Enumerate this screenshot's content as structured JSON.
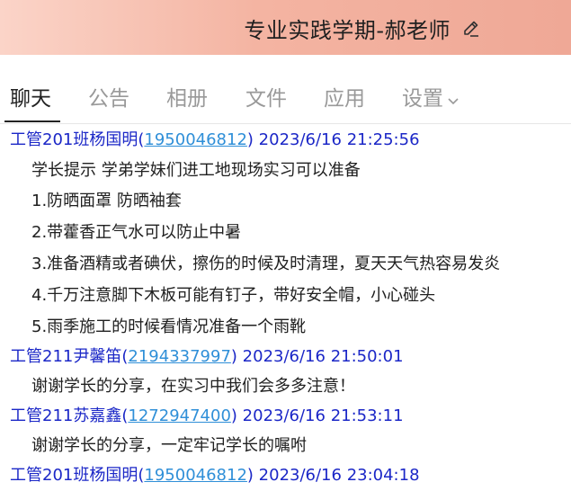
{
  "window": {
    "title": "专业实践学期-郝老师",
    "edit_icon": "pencil-icon"
  },
  "tabs": [
    {
      "label": "聊天",
      "active": true
    },
    {
      "label": "公告",
      "active": false
    },
    {
      "label": "相册",
      "active": false
    },
    {
      "label": "文件",
      "active": false
    },
    {
      "label": "应用",
      "active": false
    },
    {
      "label": "设置",
      "active": false,
      "icon": "chevron-down-icon"
    }
  ],
  "messages": [
    {
      "sender": "工管201班杨国明",
      "qq": "1950046812",
      "time": "2023/6/16 21:25:56",
      "lines": [
        "学长提示 学弟学妹们进工地现场实习可以准备",
        "1.防晒面罩 防晒袖套",
        "2.带藿香正气水可以防止中暑",
        "3.准备酒精或者碘伏，擦伤的时候及时清理，夏天天气热容易发炎",
        "4.千万注意脚下木板可能有钉子，带好安全帽，小心碰头",
        "5.雨季施工的时候看情况准备一个雨靴"
      ]
    },
    {
      "sender": "工管211尹馨笛",
      "qq": "2194337997",
      "time": "2023/6/16 21:50:01",
      "lines": [
        "谢谢学长的分享，在实习中我们会多多注意！"
      ]
    },
    {
      "sender": "工管211苏嘉鑫",
      "qq": "1272947400",
      "time": "2023/6/16 21:53:11",
      "lines": [
        "谢谢学长的分享，一定牢记学长的嘱咐"
      ]
    },
    {
      "sender": "工管201班杨国明",
      "qq": "1950046812",
      "time": "2023/6/16 23:04:18",
      "lines": []
    }
  ],
  "colors": {
    "sender": "#1b27c7",
    "qq_link": "#2f8fd8",
    "titlebar_start": "#fbd4c8",
    "titlebar_end": "#efa896"
  }
}
